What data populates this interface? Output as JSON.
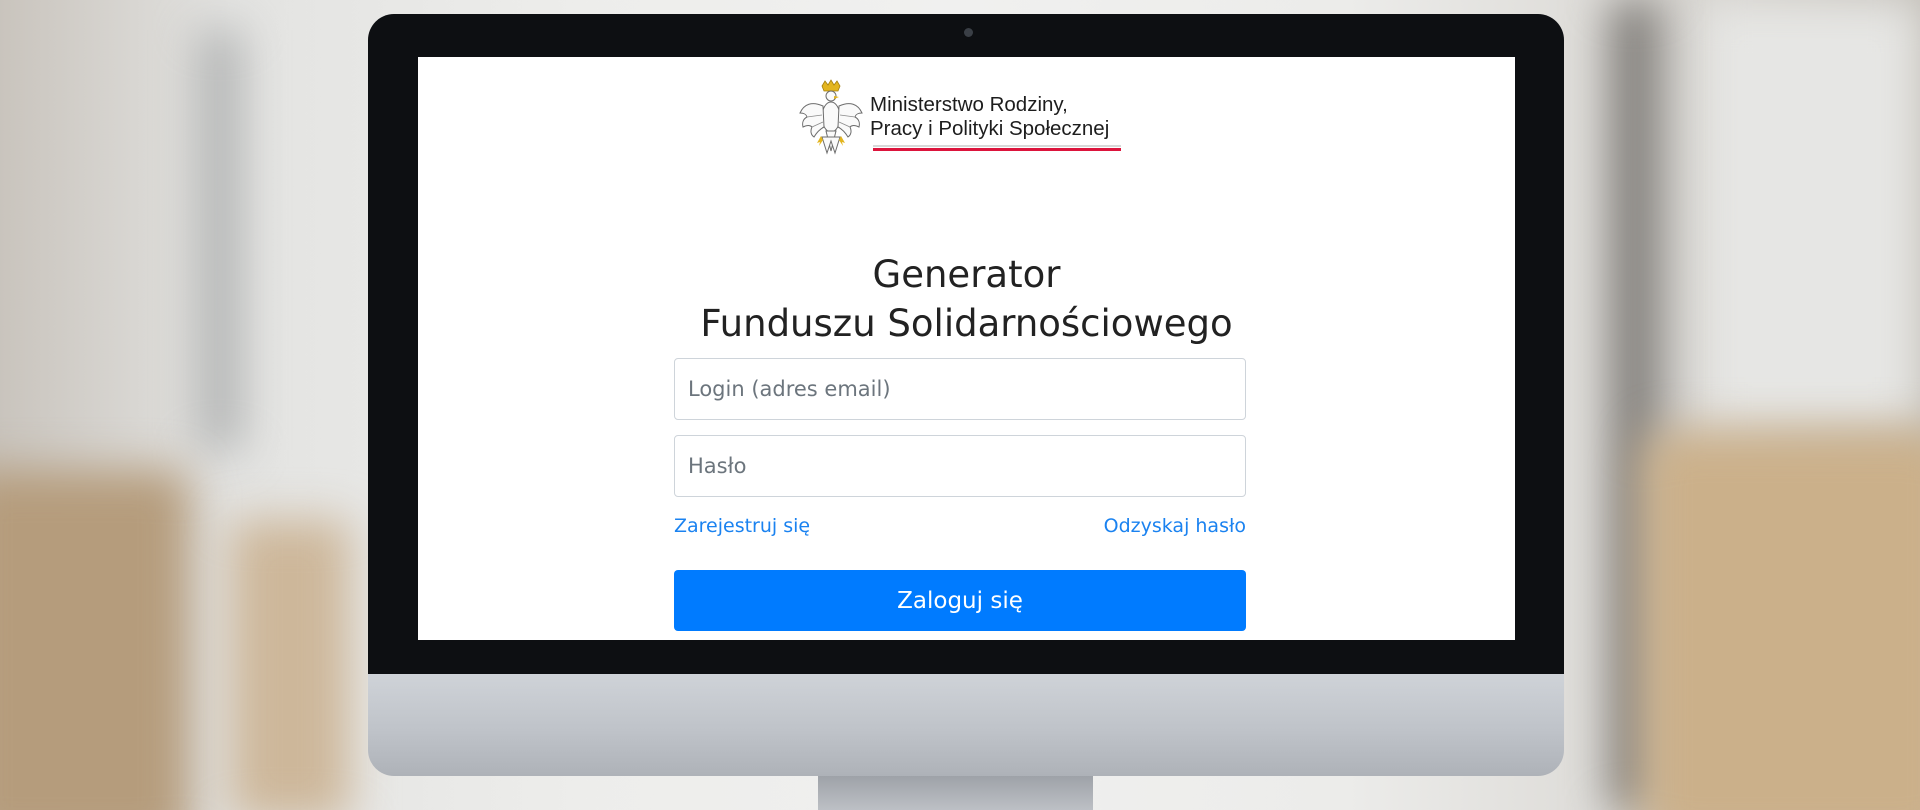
{
  "header": {
    "ministry_line1": "Ministerstwo Rodziny,",
    "ministry_line2": "Pracy i Polityki Społecznej",
    "emblem_icon": "polish-eagle-emblem-icon",
    "flag_colors": [
      "#ffffff",
      "#dc143c"
    ]
  },
  "main": {
    "title_line1": "Generator",
    "title_line2": "Funduszu Solidarnościowego"
  },
  "form": {
    "login_placeholder": "Login (adres email)",
    "login_value": "",
    "password_placeholder": "Hasło",
    "password_value": "",
    "register_link": "Zarejestruj się",
    "recover_link": "Odzyskaj hasło",
    "submit_label": "Zaloguj się"
  },
  "colors": {
    "primary": "#007bff",
    "link": "#1a82f0",
    "title": "#222222",
    "accent_red": "#dc143c"
  }
}
